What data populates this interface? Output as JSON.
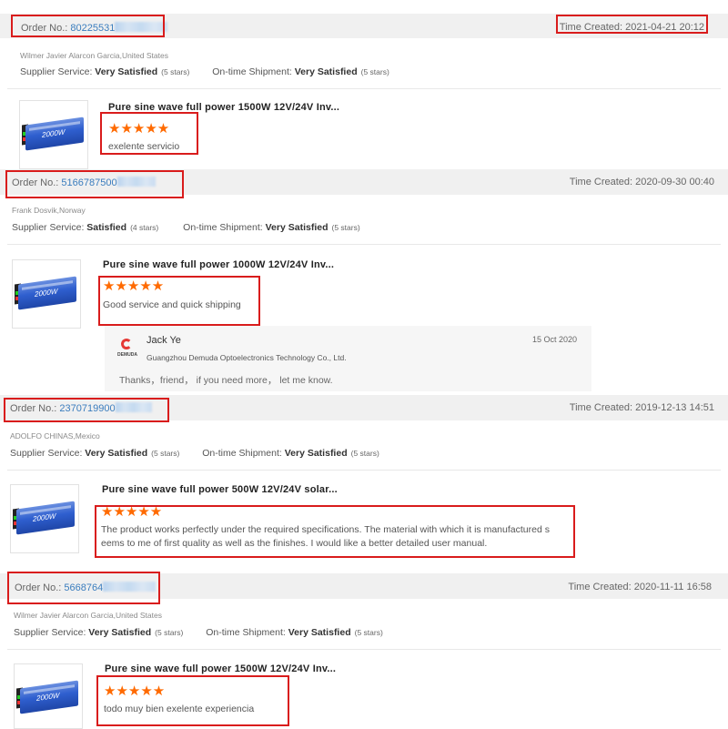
{
  "labels": {
    "order_no": "Order No.:",
    "time_created": "Time Created:",
    "supplier_service": "Supplier Service:",
    "on_time_shipment": "On-time Shipment:"
  },
  "orders": [
    {
      "order_no": "80225531",
      "time_created": "2021-04-21 20:12",
      "buyer": "Wilmer Javier Alarcon Garcia,United States",
      "supplier_rating": "Very Satisfied",
      "supplier_stars": "(5 stars)",
      "shipment_rating": "Very Satisfied",
      "shipment_stars": "(5 stars)",
      "product_title": "Pure sine wave full power 1500W 12V/24V Inv...",
      "stars": "★★★★★",
      "comment": "exelente servicio"
    },
    {
      "order_no": "5166787500",
      "time_created": "2020-09-30 00:40",
      "buyer": "Frank Dosvik,Norway",
      "supplier_rating": "Satisfied",
      "supplier_stars": "(4 stars)",
      "shipment_rating": "Very Satisfied",
      "shipment_stars": "(5 stars)",
      "product_title": "Pure sine wave full power 1000W 12V/24V Inv...",
      "stars": "★★★★★",
      "comment": "Good service and quick shipping",
      "reply": {
        "name": "Jack Ye",
        "company": "Guangzhou Demuda Optoelectronics Technology Co., Ltd.",
        "date": "15 Oct 2020",
        "message": "Thanks，friend， if you need more， let  me know.",
        "logo_text": "DEMUDA"
      }
    },
    {
      "order_no": "2370719900",
      "time_created": "2019-12-13 14:51",
      "buyer": "ADOLFO CHINAS,Mexico",
      "supplier_rating": "Very Satisfied",
      "supplier_stars": "(5 stars)",
      "shipment_rating": "Very Satisfied",
      "shipment_stars": "(5 stars)",
      "product_title": "Pure sine wave full power 500W 12V/24V solar...",
      "stars": "★★★★★",
      "comment": "The product works perfectly under the required specifications. The material with which it is manufactured s eems to me of first quality as well as the finishes. I would like a better detailed user manual."
    },
    {
      "order_no": "5668764",
      "time_created": "2020-11-11 16:58",
      "buyer": "Wilmer Javier Alarcon Garcia,United States",
      "supplier_rating": "Very Satisfied",
      "supplier_stars": "(5 stars)",
      "shipment_rating": "Very Satisfied",
      "shipment_stars": "(5 stars)",
      "product_title": "Pure sine wave full power 1500W 12V/24V Inv...",
      "stars": "★★★★★",
      "comment": "todo muy bien exelente experiencia"
    }
  ],
  "thumb_label": "2000W",
  "colors": {
    "accent_link": "#3a7dbe",
    "star": "#ff6a00",
    "highlight_box": "#d91c1c",
    "order_bar": "#f0f0f0"
  }
}
